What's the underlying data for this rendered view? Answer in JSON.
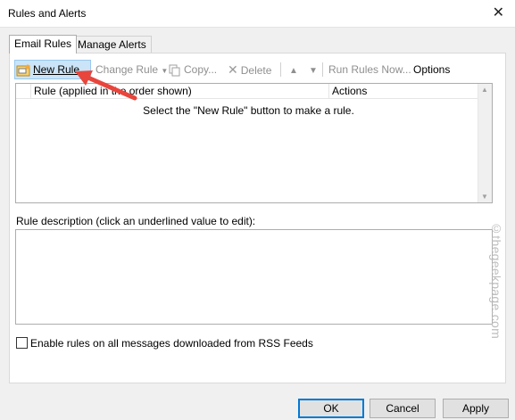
{
  "window": {
    "title": "Rules and Alerts",
    "close_glyph": "✕"
  },
  "tabs": [
    {
      "label": "Email Rules",
      "active": true
    },
    {
      "label": "Manage Alerts",
      "active": false
    }
  ],
  "toolbar": {
    "new_rule": "New Rule...",
    "change_rule": "Change Rule",
    "copy": "Copy...",
    "delete": "Delete",
    "run_rules_now": "Run Rules Now...",
    "options": "Options"
  },
  "rules_grid": {
    "columns": [
      "Rule (applied in the order shown)",
      "Actions"
    ],
    "empty_message": "Select the \"New Rule\" button to make a rule."
  },
  "description": {
    "label": "Rule description (click an underlined value to edit):"
  },
  "rss_checkbox": {
    "label": "Enable rules on all messages downloaded from RSS Feeds",
    "checked": false
  },
  "buttons": {
    "ok": "OK",
    "cancel": "Cancel",
    "apply": "Apply"
  },
  "watermark": "©thegeekpage.com",
  "colors": {
    "accent": "#0078d7",
    "annotation_arrow": "#e8453c",
    "highlight": "#cce4f7"
  }
}
